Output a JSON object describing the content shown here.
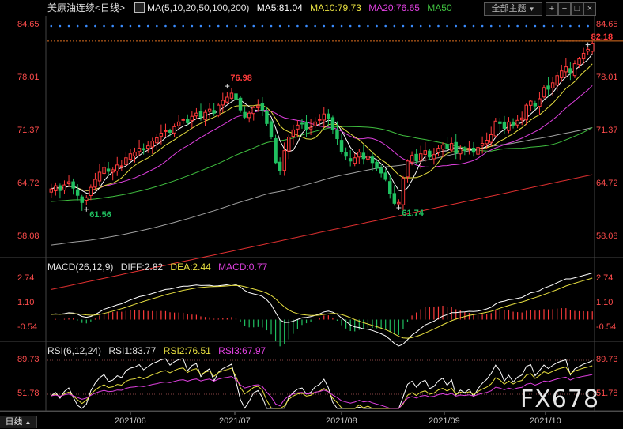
{
  "header": {
    "symbol": "美原油连续",
    "period": "<日线>",
    "ma_params": "MA(5,10,20,50,100,200)",
    "ma5": "MA5:81.04",
    "ma10": "MA10:79.73",
    "ma20": "MA20:76.65",
    "ma50": "MA50",
    "theme_button": "全部主题",
    "dropdown_icon": "triangle-down-icon"
  },
  "macd_header": {
    "params": "MACD(26,12,9)",
    "diff": "DIFF:2.82",
    "dea": "DEA:2.44",
    "macd": "MACD:0.77"
  },
  "rsi_header": {
    "params": "RSI(6,12,24)",
    "rsi1": "RSI1:83.77",
    "rsi2": "RSI2:76.51",
    "rsi3": "RSI3:67.97"
  },
  "footer": {
    "period_tab": "日线"
  },
  "watermark": "FX678",
  "colors": {
    "up": "#ff3b3b",
    "down": "#20c060",
    "ma5": "#ffffff",
    "ma10": "#e8e040",
    "ma20": "#e040e0",
    "ma50": "#40c040",
    "ma100": "#a0a0a0",
    "ma200": "#e03030",
    "axis_text": "#ff4c4c"
  },
  "chart_data": [
    {
      "type": "candlestick",
      "y_ticks": [
        84.65,
        78.01,
        71.37,
        64.72,
        58.08
      ],
      "ylim": [
        55.5,
        85.8
      ],
      "x_ticks": [
        "2021/06",
        "2021/07",
        "2021/08",
        "2021/09",
        "2021/10"
      ],
      "annotations": [
        {
          "label": "76.98",
          "value": 76.98
        },
        {
          "label": "61.56",
          "value": 61.56
        },
        {
          "label": "61.74",
          "value": 61.74
        },
        {
          "label": "82.18",
          "value": 82.18
        }
      ],
      "close": [
        64.1,
        64.5,
        63.9,
        64.6,
        65.0,
        64.2,
        63.3,
        62.4,
        63.0,
        64.3,
        65.3,
        66.2,
        66.8,
        66.3,
        66.5,
        67.1,
        67.0,
        68.0,
        68.5,
        68.7,
        69.2,
        69.0,
        69.5,
        70.1,
        70.5,
        71.1,
        71.4,
        71.2,
        71.9,
        72.5,
        72.8,
        72.4,
        73.2,
        73.6,
        73.1,
        73.7,
        74.1,
        73.6,
        74.6,
        75.2,
        75.6,
        76.1,
        75.3,
        74.0,
        73.1,
        73.6,
        74.3,
        74.5,
        74.0,
        72.3,
        70.6,
        67.4,
        66.4,
        68.9,
        70.6,
        71.5,
        72.1,
        72.3,
        71.6,
        71.8,
        72.5,
        72.8,
        73.5,
        72.9,
        71.5,
        70.4,
        68.8,
        68.2,
        67.6,
        68.0,
        68.7,
        67.9,
        68.2,
        67.4,
        66.7,
        66.1,
        65.3,
        63.5,
        62.3,
        62.4,
        65.4,
        67.6,
        68.3,
        67.6,
        68.5,
        68.9,
        68.1,
        68.4,
        69.2,
        69.6,
        69.1,
        69.8,
        68.6,
        69.1,
        68.9,
        69.2,
        68.7,
        69.3,
        69.8,
        70.2,
        70.9,
        72.6,
        72.3,
        71.7,
        72.5,
        72.1,
        72.7,
        73.0,
        74.6,
        75.1,
        74.5,
        75.4,
        76.8,
        76.6,
        77.4,
        78.3,
        78.9,
        79.4,
        78.6,
        79.8,
        80.4,
        81.1,
        81.6,
        82.3
      ],
      "rsi": {
        "y_ticks": [
          89.73,
          51.78
        ]
      },
      "macd": {
        "y_ticks": [
          2.74,
          1.1,
          -0.54
        ]
      }
    }
  ]
}
